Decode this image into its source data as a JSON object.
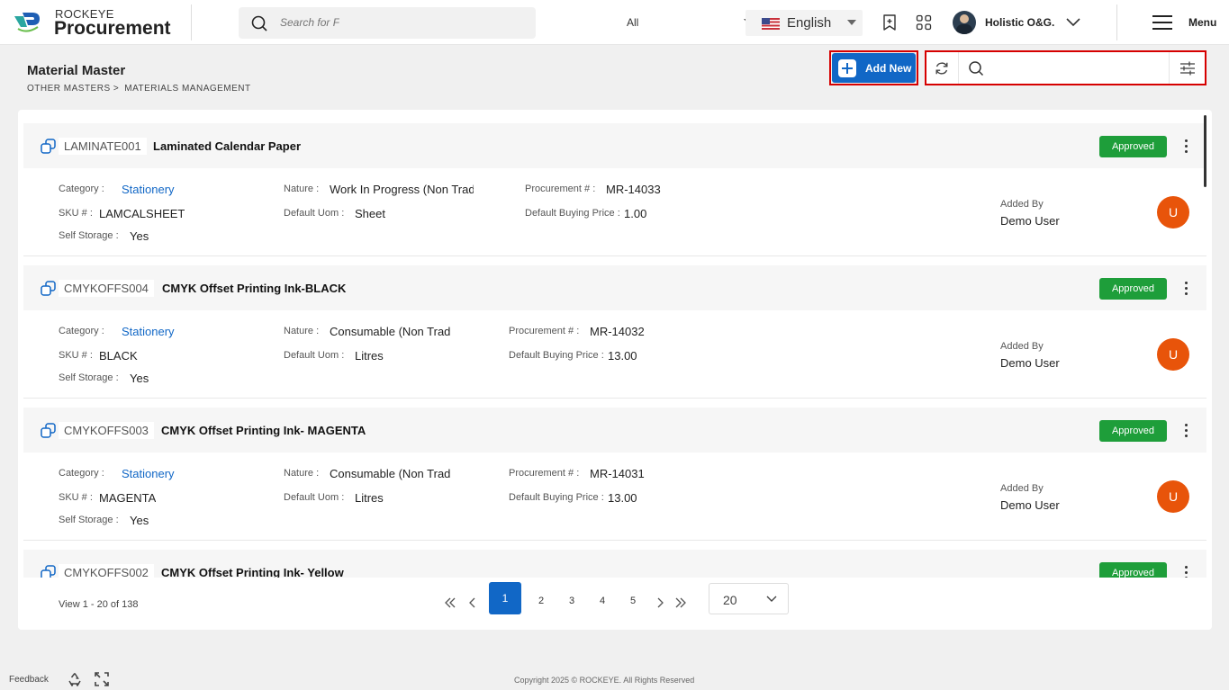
{
  "brand": {
    "line1": "ROCKEYE",
    "line2": "Procurement"
  },
  "top_search": {
    "placeholder": "Search for F",
    "scope": "All"
  },
  "language": "English",
  "user": {
    "name": "Holistic O&G."
  },
  "menu_label": "Menu",
  "page": {
    "title": "Material Master",
    "breadcrumb": [
      "OTHER MASTERS >",
      "MATERIALS MANAGEMENT"
    ],
    "add_label": "Add New",
    "search_placeholder": ""
  },
  "labels": {
    "category": "Category :",
    "nature": "Nature :",
    "procurement": "Procurement # :",
    "sku": "SKU # :",
    "uom": "Default Uom :",
    "price": "Default Buying Price :",
    "storage": "Self Storage :",
    "added_by": "Added By"
  },
  "materials": [
    {
      "code": "LAMINATE001",
      "name": "Laminated Calendar Paper",
      "status": "Approved",
      "category": "Stationery",
      "nature": "Work In Progress (Non Trad",
      "procurement": "MR-14033",
      "sku": "LAMCALSHEET",
      "uom": "Sheet",
      "price": "1.00",
      "self_storage": "Yes",
      "added_by": "Demo User",
      "avatar": "U"
    },
    {
      "code": "CMYKOFFS004",
      "name": "CMYK Offset Printing Ink-BLACK",
      "status": "Approved",
      "category": "Stationery",
      "nature": "Consumable (Non Trad",
      "procurement": "MR-14032",
      "sku": "BLACK",
      "uom": "Litres",
      "price": "13.00",
      "self_storage": "Yes",
      "added_by": "Demo User",
      "avatar": "U"
    },
    {
      "code": "CMYKOFFS003",
      "name": "CMYK Offset Printing Ink- MAGENTA",
      "status": "Approved",
      "category": "Stationery",
      "nature": "Consumable (Non Trad",
      "procurement": "MR-14031",
      "sku": "MAGENTA",
      "uom": "Litres",
      "price": "13.00",
      "self_storage": "Yes",
      "added_by": "Demo User",
      "avatar": "U"
    },
    {
      "code": "CMYKOFFS002",
      "name": "CMYK Offset Printing Ink- Yellow",
      "status": "Approved"
    }
  ],
  "pagination": {
    "summary": "View 1 - 20 of 138",
    "current": "1",
    "pages": [
      "2",
      "3",
      "4",
      "5"
    ],
    "page_size": "20"
  },
  "footer": {
    "feedback": "Feedback",
    "copyright": "Copyright 2025 © ROCKEYE. All Rights Reserved"
  },
  "colors": {
    "accent": "#1167c6",
    "approved": "#1e9e3a",
    "avatar": "#e8540a",
    "highlight": "#d60000"
  }
}
